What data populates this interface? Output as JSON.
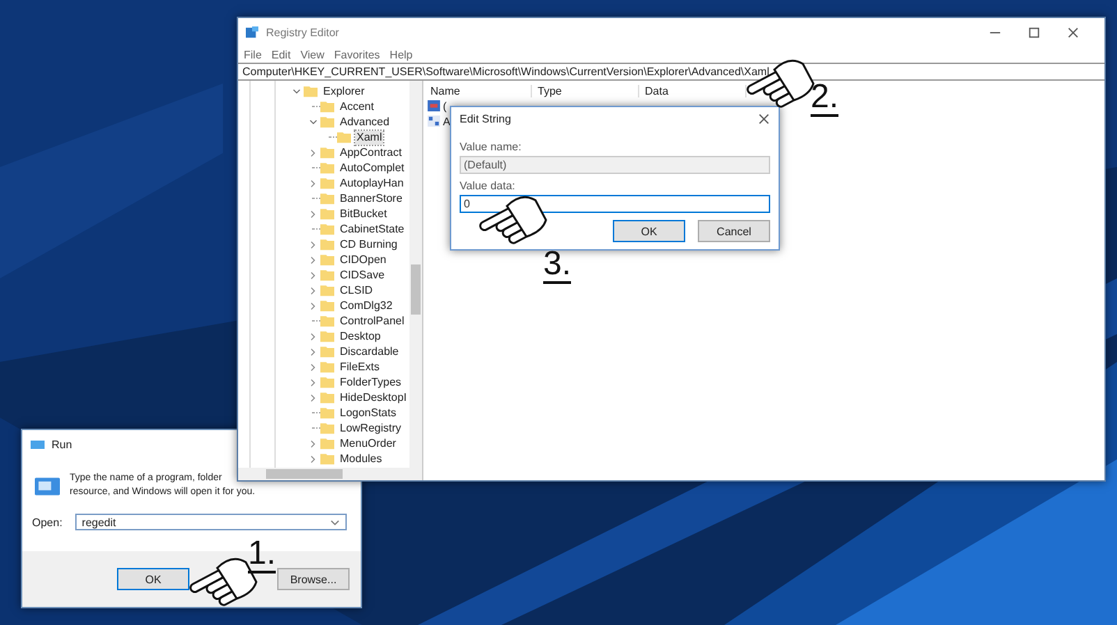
{
  "registry_editor": {
    "title": "Registry Editor",
    "menu": [
      "File",
      "Edit",
      "View",
      "Favorites",
      "Help"
    ],
    "address": "Computer\\HKEY_CURRENT_USER\\Software\\Microsoft\\Windows\\CurrentVersion\\Explorer\\Advanced\\Xaml",
    "tree": [
      {
        "label": "Explorer",
        "kind": "expanded",
        "selected": false,
        "children": [
          {
            "label": "Accent",
            "kind": "leaf",
            "selected": false
          },
          {
            "label": "Advanced",
            "kind": "expanded",
            "selected": false,
            "children": [
              {
                "label": "Xaml",
                "kind": "leaf",
                "selected": true
              }
            ]
          },
          {
            "label": "AppContract",
            "kind": "collapsed",
            "selected": false
          },
          {
            "label": "AutoComplet",
            "kind": "leaf",
            "selected": false
          },
          {
            "label": "AutoplayHan",
            "kind": "collapsed",
            "selected": false
          },
          {
            "label": "BannerStore",
            "kind": "leaf",
            "selected": false
          },
          {
            "label": "BitBucket",
            "kind": "collapsed",
            "selected": false
          },
          {
            "label": "CabinetState",
            "kind": "leaf",
            "selected": false
          },
          {
            "label": "CD Burning",
            "kind": "collapsed",
            "selected": false
          },
          {
            "label": "CIDOpen",
            "kind": "collapsed",
            "selected": false
          },
          {
            "label": "CIDSave",
            "kind": "collapsed",
            "selected": false
          },
          {
            "label": "CLSID",
            "kind": "collapsed",
            "selected": false
          },
          {
            "label": "ComDlg32",
            "kind": "collapsed",
            "selected": false
          },
          {
            "label": "ControlPanel",
            "kind": "leaf",
            "selected": false
          },
          {
            "label": "Desktop",
            "kind": "collapsed",
            "selected": false
          },
          {
            "label": "Discardable",
            "kind": "collapsed",
            "selected": false
          },
          {
            "label": "FileExts",
            "kind": "collapsed",
            "selected": false
          },
          {
            "label": "FolderTypes",
            "kind": "collapsed",
            "selected": false
          },
          {
            "label": "HideDesktopI",
            "kind": "collapsed",
            "selected": false
          },
          {
            "label": "LogonStats",
            "kind": "leaf",
            "selected": false
          },
          {
            "label": "LowRegistry",
            "kind": "leaf",
            "selected": false
          },
          {
            "label": "MenuOrder",
            "kind": "collapsed",
            "selected": false
          },
          {
            "label": "Modules",
            "kind": "collapsed",
            "selected": false
          }
        ]
      }
    ],
    "columns": [
      "Name",
      "Type",
      "Data"
    ],
    "values": [
      {
        "name": "(",
        "kind": "string"
      },
      {
        "name": "A",
        "kind": "binary"
      }
    ]
  },
  "edit_string": {
    "title": "Edit String",
    "value_name_label": "Value name:",
    "value_name": "(Default)",
    "value_data_label": "Value data:",
    "value_data": "0",
    "buttons": [
      "OK",
      "Cancel"
    ]
  },
  "run": {
    "title": "Run",
    "description": "Type the name of a program, folder",
    "description_2": "resource, and Windows will open it for you.",
    "open_label": "Open:",
    "value": "regedit",
    "buttons": [
      "OK",
      "Browse..."
    ]
  },
  "steps": [
    {
      "label": "1."
    },
    {
      "label": "2."
    },
    {
      "label": "3."
    }
  ]
}
